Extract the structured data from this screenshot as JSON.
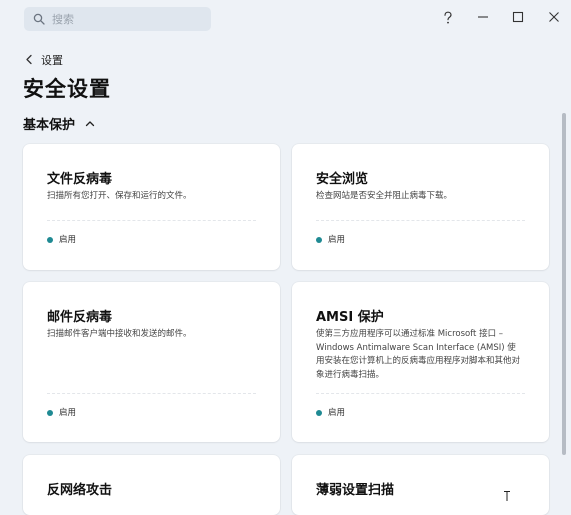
{
  "search": {
    "placeholder": "搜索",
    "value": ""
  },
  "window_controls": [
    "help-icon",
    "minimize-icon",
    "maximize-icon",
    "close-icon"
  ],
  "nav": {
    "back_label": "设置"
  },
  "page": {
    "title": "安全设置"
  },
  "section": {
    "title": "基本保护",
    "expanded": true
  },
  "cards": [
    {
      "title": "文件反病毒",
      "description": "扫描所有您打开、保存和运行的文件。",
      "status": "启用"
    },
    {
      "title": "安全浏览",
      "description": "检查网站是否安全并阻止病毒下载。",
      "status": "启用"
    },
    {
      "title": "邮件反病毒",
      "description": "扫描邮件客户端中接收和发送的邮件。",
      "status": "启用"
    },
    {
      "title": "AMSI 保护",
      "description": "使第三方应用程序可以通过标准 Microsoft 接口 – Windows Antimalware Scan Interface (AMSI) 使用安装在您计算机上的反病毒应用程序对脚本和其他对象进行病毒扫描。",
      "status": "启用"
    },
    {
      "title": "反网络攻击",
      "description": "",
      "status": ""
    },
    {
      "title": "薄弱设置扫描",
      "description": "",
      "status": ""
    }
  ],
  "colors": {
    "background": "#eef2f7",
    "card": "#ffffff",
    "status_dot": "#1f8a93",
    "search_bg": "#dfe6ee"
  }
}
